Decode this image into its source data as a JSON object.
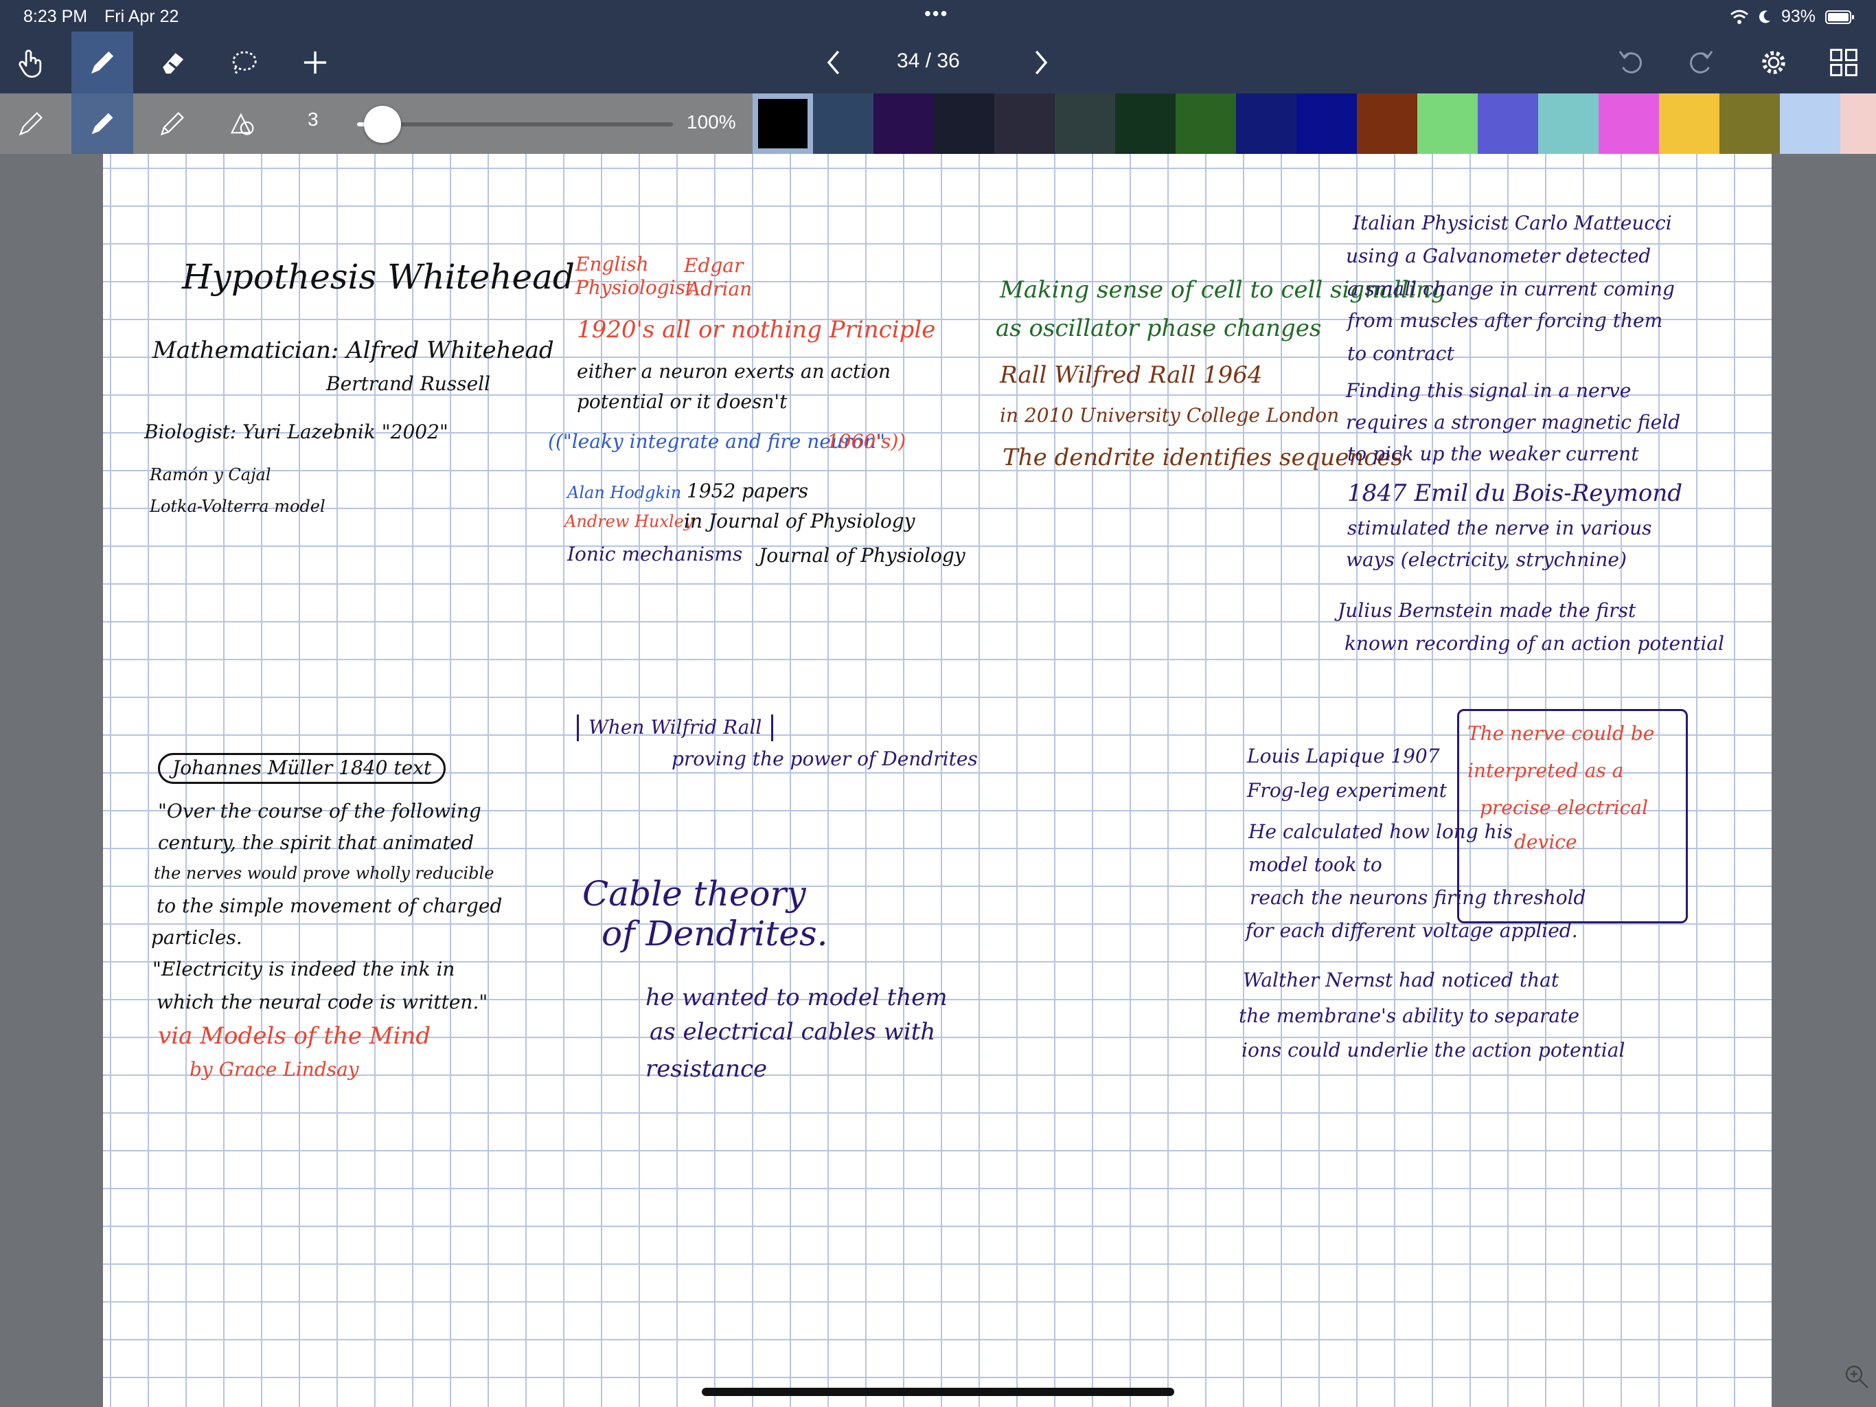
{
  "status_bar": {
    "time": "8:23 PM",
    "date": "Fri Apr 22",
    "battery": "93%",
    "dots": "•••"
  },
  "toolbar": {
    "page_counter": "34 / 36",
    "icons": [
      "hand-icon",
      "pen-icon",
      "eraser-icon",
      "lasso-icon",
      "plus-icon",
      "chevron-left-icon",
      "chevron-right-icon",
      "undo-icon",
      "redo-icon",
      "gear-icon",
      "grid-icon"
    ]
  },
  "subtoolbar": {
    "thickness_value": "3",
    "opacity_label": "100%",
    "slider_fraction": 0.08,
    "palette": [
      "#000000",
      "#2f4566",
      "#2a0f4f",
      "#1a1d2e",
      "#2a2a3a",
      "#2f3f3f",
      "#14331e",
      "#2a6322",
      "#121a77",
      "#0a0f8d",
      "#7a2f10",
      "#7ad87a",
      "#5a5ad2",
      "#7cc8c8",
      "#e45ce0",
      "#f2c43a",
      "#7a7428",
      "#b8d0f2",
      "#f3d0cc"
    ],
    "selected_color": "#000000"
  },
  "notes": {
    "col1": {
      "title": "Hypothesis Whitehead",
      "line1": "Mathematician: Alfred Whitehead",
      "line2": "Bertrand Russell",
      "line3": "Biologist: Yuri Lazebnik \"2002\"",
      "line4": "Ramón y Cajal",
      "line5": "Lotka-Volterra model"
    },
    "col2": {
      "line1a": "English",
      "line1b": "Physiologist",
      "line1c": "Edgar",
      "line1d": "Adrian",
      "line2": "1920's all or nothing Principle",
      "line3": "either a neuron exerts an action",
      "line4": "potential or it doesn't",
      "line5a": "((\"leaky integrate and fire neuron\"",
      "line5b": "1960's))",
      "line6a": "Alan Hodgkin",
      "line6b": "1952 papers",
      "line7a": "Andrew Huxley",
      "line7b": "in Journal of Physiology",
      "line8a": "Ionic mechanisms",
      "line8b": "Journal of Physiology"
    },
    "col3": {
      "line1": "Making sense of cell to cell signalling",
      "line2": "as oscillator phase changes",
      "line3": "Rall Wilfred Rall 1964",
      "line4": "in 2010 University College London",
      "line5": "The dendrite identifies sequences"
    },
    "col4": {
      "line1": "Italian Physicist Carlo Matteucci",
      "line2": "using a Galvanometer detected",
      "line3": "a small change in current coming",
      "line4": "from muscles after forcing them",
      "line5": "to contract",
      "line6": "Finding this signal in a nerve",
      "line7": "requires a stronger magnetic field",
      "line8": "to pick up the weaker current",
      "line9": "1847 Emil du Bois-Reymond",
      "line10": "stimulated the nerve in various",
      "line11": "ways (electricity, strychnine)",
      "line12": "Julius Bernstein made the first",
      "line13": "known recording of an action potential"
    },
    "col1_bottom": {
      "title": "Johannes Müller 1840 text",
      "line1": "\"Over the course of the following",
      "line2": "century, the spirit that animated",
      "line3": "the nerves would prove wholly reducible",
      "line4": "to the simple movement of charged",
      "line5": "particles.",
      "line6": "\"Electricity is indeed the ink in",
      "line7": "which the neural code is written.\"",
      "line8": "via Models of the Mind",
      "line9": "by Grace Lindsay"
    },
    "col2_bottom": {
      "line1": "When Wilfrid Rall",
      "line2": "proving the power of Dendrites",
      "line3": "Cable theory",
      "line4": "of Dendrites.",
      "line5": "he wanted to model them",
      "line6": "as electrical cables with",
      "line7": "resistance"
    },
    "col4_bottom": {
      "line1": "Louis Lapique 1907",
      "line2": "Frog-leg experiment",
      "line3": "He calculated how long his",
      "line4": "model took to",
      "line5": "reach the neurons firing threshold",
      "line6": "for each different voltage applied.",
      "box1": "The nerve could be",
      "box2": "interpreted as a",
      "box3": "precise electrical",
      "box4": "device",
      "line7": "Walther Nernst had noticed that",
      "line8": "the membrane's ability to separate",
      "line9": "ions could underlie the action potential"
    }
  }
}
